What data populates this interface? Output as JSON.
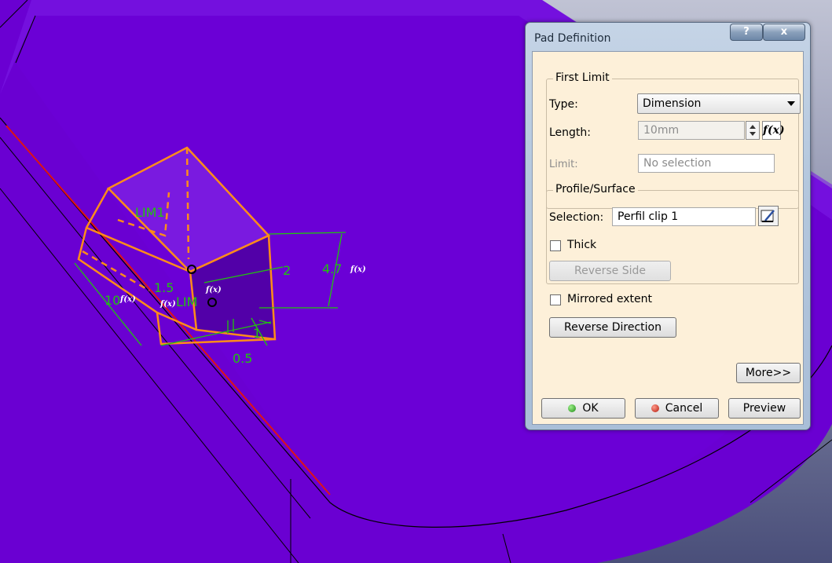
{
  "viewport": {
    "sketch_labels": {
      "lim1": "LIM1",
      "lim2": "LIM",
      "dim_47": "4.7",
      "dim_2": "2",
      "dim_1": "1",
      "dim_15": "1.5",
      "dim_05": "0.5",
      "dim_10": "10",
      "fx": "f(x)"
    },
    "colors": {
      "part_face": "#6b00d6",
      "background_top": "#c0c3d4",
      "background_bottom": "#4a4f7a",
      "sketch": "#ff8c1a",
      "constraints": "#22c40f",
      "axis_line": "#e01414"
    }
  },
  "dialog": {
    "title": "Pad Definition",
    "help_label": "?",
    "close_label": "x",
    "first_limit": {
      "group_title": "First Limit",
      "type_label": "Type:",
      "type_value": "Dimension",
      "length_label": "Length:",
      "length_value": "10mm",
      "limit_label": "Limit:",
      "limit_value": "No selection"
    },
    "profile": {
      "group_title": "Profile/Surface",
      "selection_label": "Selection:",
      "selection_value": "Perfil clip 1",
      "thick_label": "Thick",
      "reverse_side_label": "Reverse Side"
    },
    "mirrored_label": "Mirrored extent",
    "reverse_direction_label": "Reverse Direction",
    "more_label": "More>>",
    "ok_label": "OK",
    "cancel_label": "Cancel",
    "preview_label": "Preview"
  }
}
